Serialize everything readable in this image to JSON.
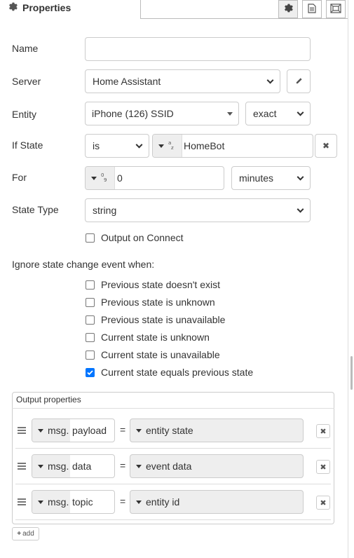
{
  "header": {
    "title": "Properties",
    "tabs": [
      {
        "icon": "gear-icon",
        "active": true
      },
      {
        "icon": "document-icon",
        "active": false
      },
      {
        "icon": "frame-icon",
        "active": false
      }
    ]
  },
  "form": {
    "name": {
      "label": "Name",
      "value": ""
    },
    "server": {
      "label": "Server",
      "value": "Home Assistant"
    },
    "entity": {
      "label": "Entity",
      "value": "iPhone (126) SSID",
      "match": "exact"
    },
    "if_state": {
      "label": "If State",
      "operator": "is",
      "type_glyph": "az",
      "value": "HomeBot"
    },
    "for": {
      "label": "For",
      "type_glyph": "09",
      "value": "0",
      "unit": "minutes"
    },
    "state_type": {
      "label": "State Type",
      "value": "string"
    },
    "output_on_connect": {
      "label": "Output on Connect",
      "checked": false
    }
  },
  "ignore": {
    "heading": "Ignore state change event when:",
    "options": [
      {
        "label": "Previous state doesn't exist",
        "checked": false
      },
      {
        "label": "Previous state is unknown",
        "checked": false
      },
      {
        "label": "Previous state is unavailable",
        "checked": false
      },
      {
        "label": "Current state is unknown",
        "checked": false
      },
      {
        "label": "Current state is unavailable",
        "checked": false
      },
      {
        "label": "Current state equals previous state",
        "checked": true
      }
    ]
  },
  "output_properties": {
    "title": "Output properties",
    "rows": [
      {
        "prefix": "msg.",
        "property": "payload",
        "equals": "=",
        "value": "entity state"
      },
      {
        "prefix": "msg.",
        "property": "data",
        "equals": "=",
        "value": "event data"
      },
      {
        "prefix": "msg.",
        "property": "topic",
        "equals": "=",
        "value": "entity id"
      }
    ],
    "add_label": "add"
  },
  "colors": {
    "checkbox_checked": "#0075ff",
    "field_border": "#cccccc",
    "typed_bg": "#eeeeee"
  }
}
